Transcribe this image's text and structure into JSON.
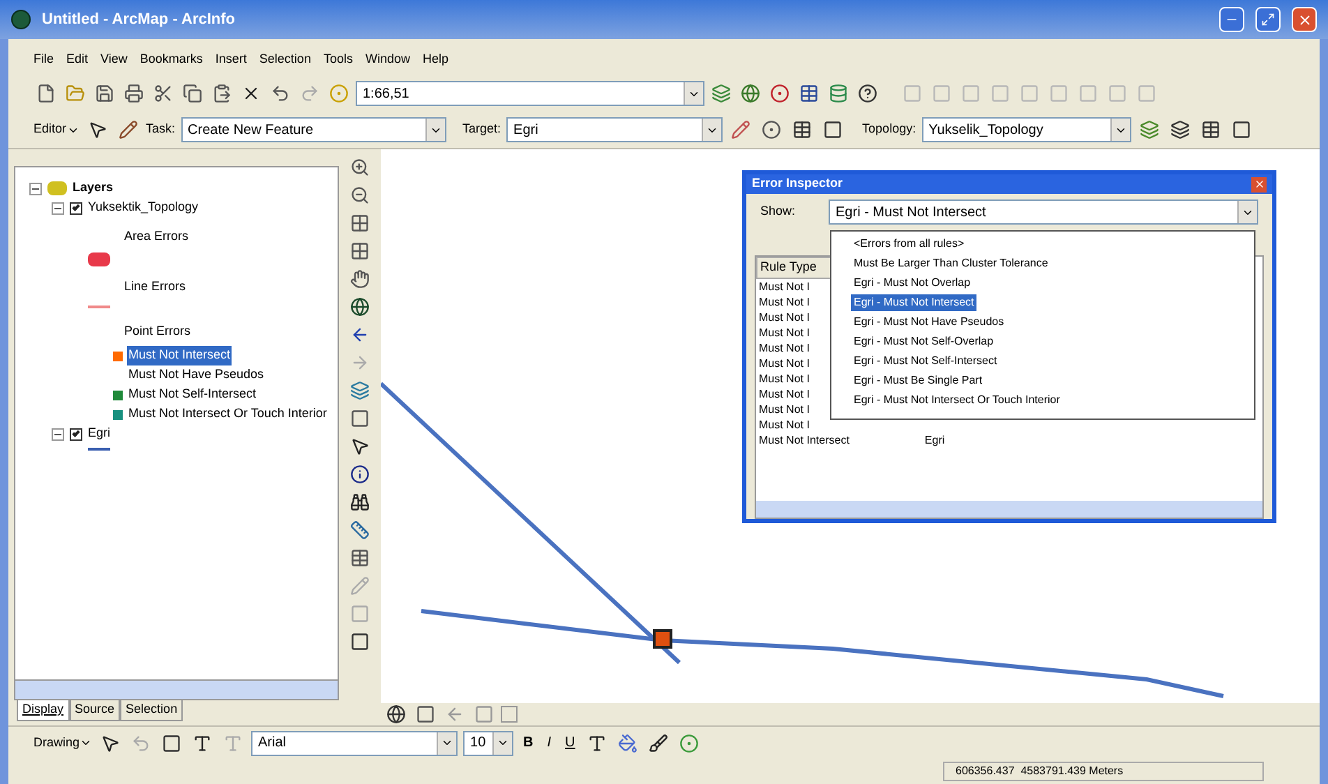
{
  "window": {
    "title": "Untitled - ArcMap - ArcInfo"
  },
  "menu": [
    "File",
    "Edit",
    "View",
    "Bookmarks",
    "Insert",
    "Selection",
    "Tools",
    "Window",
    "Help"
  ],
  "standard_toolbar": {
    "scale": "1:66,51"
  },
  "editor_toolbar": {
    "editor": "Editor",
    "task_label": "Task:",
    "task": "Create New Feature",
    "target_label": "Target:",
    "target": "Egri",
    "topology_label": "Topology:",
    "topology": "Yukselik_Topology"
  },
  "toc": {
    "root": "Layers",
    "layers": [
      {
        "name": "Yuksektik_Topology",
        "checked": true,
        "children": [
          {
            "kind": "heading",
            "label": "Area Errors"
          },
          {
            "kind": "area",
            "color": "#e8394a"
          },
          {
            "kind": "heading",
            "label": "Line Errors"
          },
          {
            "kind": "line",
            "color": "#f08a8a"
          },
          {
            "kind": "heading",
            "label": "Point Errors"
          },
          {
            "kind": "point",
            "color": "#ff6a00",
            "label": "Must Not Intersect",
            "selected": true
          },
          {
            "kind": "point",
            "label": "Must Not Have Pseudos",
            "selected": false
          },
          {
            "kind": "point",
            "color": "#1f8a3a",
            "label": "Must Not Self-Intersect",
            "selected": false
          },
          {
            "kind": "point",
            "color": "#17907f",
            "label": "Must Not Intersect Or Touch Interior",
            "selected": false
          }
        ]
      },
      {
        "name": "Egri",
        "checked": true,
        "children": [
          {
            "kind": "line",
            "color": "#3a5fb0"
          }
        ]
      }
    ],
    "tabs": [
      {
        "label": "Display",
        "selected": true
      },
      {
        "label": "Source",
        "selected": false
      },
      {
        "label": "Selection",
        "selected": false
      }
    ]
  },
  "error_inspector": {
    "title": "Error Inspector",
    "show_label": "Show:",
    "show_value": "Egri - Must Not Intersect",
    "options": [
      {
        "label": "<Errors from all rules>",
        "selected": false
      },
      {
        "label": "Must Be Larger Than Cluster Tolerance",
        "selected": false
      },
      {
        "label": "Egri - Must Not Overlap",
        "selected": false
      },
      {
        "label": "Egri - Must Not Intersect",
        "selected": true
      },
      {
        "label": "Egri - Must Not Have Pseudos",
        "selected": false
      },
      {
        "label": "Egri - Must Not Self-Overlap",
        "selected": false
      },
      {
        "label": "Egri - Must Not Self-Intersect",
        "selected": false
      },
      {
        "label": "Egri - Must Be Single Part",
        "selected": false
      },
      {
        "label": "Egri - Must Not Intersect Or Touch Interior",
        "selected": false
      }
    ],
    "columns": [
      "Rule Type"
    ],
    "rows": [
      [
        "Must Not I"
      ],
      [
        "Must Not I"
      ],
      [
        "Must Not I"
      ],
      [
        "Must Not I"
      ],
      [
        "Must Not I"
      ],
      [
        "Must Not I"
      ],
      [
        "Must Not I"
      ],
      [
        "Must Not I"
      ],
      [
        "Must Not I"
      ],
      [
        "Must Not I"
      ],
      [
        "Must Not Intersect",
        "Egri"
      ]
    ]
  },
  "drawing_toolbar": {
    "label": "Drawing",
    "font": "Arial",
    "size": "10",
    "bold": "B",
    "italic": "I",
    "underline": "U"
  },
  "status_bar": {
    "coordinates": "606356.437  4583791.439 Meters"
  }
}
